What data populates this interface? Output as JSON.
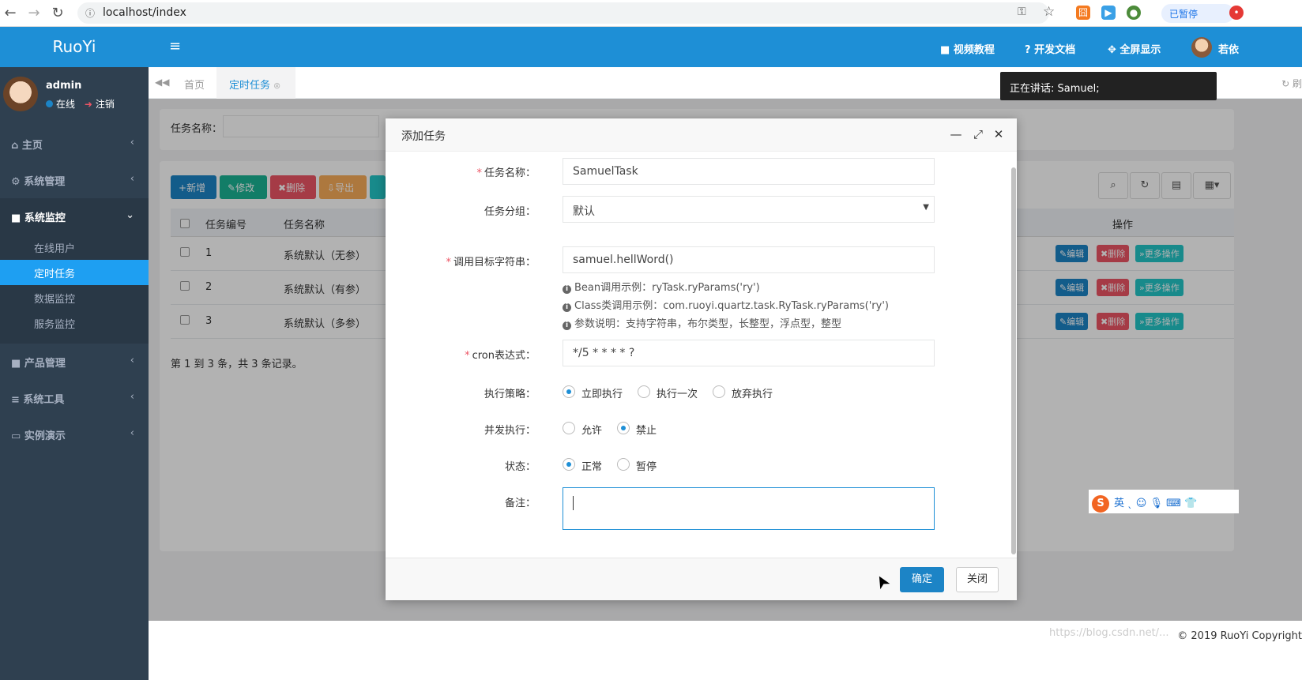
{
  "browser": {
    "url": "localhost/index",
    "paused_label": "已暂停"
  },
  "app": {
    "logo": "RuoYi"
  },
  "topnav": {
    "video": "视频教程",
    "docs": "开发文档",
    "fullscreen": "全屏显示",
    "user": "若依"
  },
  "user": {
    "name": "admin",
    "online": "在线",
    "logout": "注销"
  },
  "sidebar": {
    "items": [
      {
        "label": "主页",
        "icon": "home-icon"
      },
      {
        "label": "系统管理",
        "icon": "gear-icon"
      },
      {
        "label": "系统监控",
        "icon": "video-icon"
      },
      {
        "label": "产品管理",
        "icon": "video-icon"
      },
      {
        "label": "系统工具",
        "icon": "bars-icon"
      },
      {
        "label": "实例演示",
        "icon": "desktop-icon"
      }
    ],
    "sub": [
      "在线用户",
      "定时任务",
      "数据监控",
      "服务监控"
    ]
  },
  "tabs": {
    "home": "首页",
    "job": "定时任务",
    "refresh": "刷"
  },
  "search": {
    "label": "任务名称："
  },
  "toolbar": {
    "add": "新增",
    "edit": "修改",
    "delete": "删除",
    "export": "导出"
  },
  "table": {
    "headers": {
      "id": "任务编号",
      "name": "任务名称",
      "ops": "操作"
    },
    "rows": [
      {
        "id": "1",
        "name": "系统默认（无参）"
      },
      {
        "id": "2",
        "name": "系统默认（有参）"
      },
      {
        "id": "3",
        "name": "系统默认（多参）"
      }
    ],
    "op_edit": "编辑",
    "op_delete": "删除",
    "op_more": "更多操作",
    "pager": "第 1 到 3 条，共 3 条记录。"
  },
  "speaker": "正在讲话: Samuel;",
  "modal": {
    "title": "添加任务",
    "fields": {
      "name_label": "任务名称：",
      "name_value": "SamuelTask",
      "group_label": "任务分组：",
      "group_value": "默认",
      "target_label": "调用目标字符串：",
      "target_value": "samuel.hellWord()",
      "help1": "Bean调用示例：ryTask.ryParams('ry')",
      "help2": "Class类调用示例：com.ruoyi.quartz.task.RyTask.ryParams('ry')",
      "help3": "参数说明：支持字符串，布尔类型，长整型，浮点型，整型",
      "cron_label": "cron表达式：",
      "cron_value": "*/5 * * * * ?",
      "policy_label": "执行策略：",
      "policy_options": [
        "立即执行",
        "执行一次",
        "放弃执行"
      ],
      "concurrent_label": "并发执行：",
      "concurrent_options": [
        "允许",
        "禁止"
      ],
      "status_label": "状态：",
      "status_options": [
        "正常",
        "暂停"
      ],
      "remark_label": "备注："
    },
    "ok": "确定",
    "close": "关闭"
  },
  "ime": {
    "lang": "英"
  },
  "footer": {
    "copyright": "© 2019 RuoYi Copyright",
    "watermark": "https://blog.csdn.net/..."
  },
  "colors": {
    "primary": "#1e8fd6",
    "sidebar": "#2f4050",
    "danger": "#ed5565",
    "info": "#23c6c8",
    "warning": "#f8ac59"
  }
}
